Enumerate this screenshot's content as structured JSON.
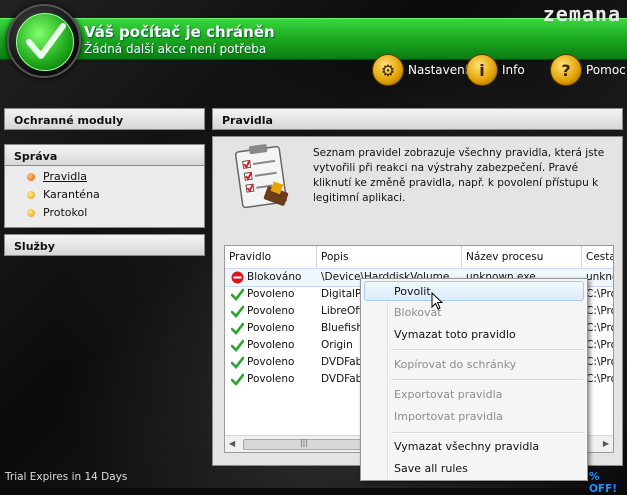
{
  "header": {
    "title": "Váš počítač je chráněn",
    "subtitle": "Žádná další akce není potřeba",
    "brand": "zemana",
    "buttons": [
      {
        "label": "Nastavení",
        "icon": "gear-icon"
      },
      {
        "label": "Info",
        "icon": "info-icon"
      },
      {
        "label": "Pomoc",
        "icon": "help-icon"
      }
    ]
  },
  "sidebar": {
    "modules_title": "Ochranné moduly",
    "management_title": "Správa",
    "items": [
      {
        "label": "Pravidla",
        "active": true
      },
      {
        "label": "Karanténa",
        "active": false
      },
      {
        "label": "Protokol",
        "active": false
      }
    ],
    "services_title": "Služby"
  },
  "main": {
    "title": "Pravidla",
    "description": "Seznam pravidel zobrazuje všechny pravidla, která jste vytvořili při reakci na výstrahy zabezpečení. Pravé kliknutí ke změně pravidla, např. k povolení přístupu k legitimní aplikaci.",
    "table": {
      "columns": [
        "Pravidlo",
        "Popis",
        "Název procesu",
        "Cesta"
      ],
      "rows": [
        {
          "status": "Blokováno",
          "type": "block",
          "popis": "\\Device\\HarddiskVolume",
          "process": "unknown.exe",
          "path": "unkno"
        },
        {
          "status": "Povoleno",
          "type": "allow",
          "popis": "DigitalPe",
          "process": "",
          "path": "C:\\Pro"
        },
        {
          "status": "Povoleno",
          "type": "allow",
          "popis": "LibreOff",
          "process": "",
          "path": "C:\\Pro"
        },
        {
          "status": "Povoleno",
          "type": "allow",
          "popis": "Bluefish",
          "process": "",
          "path": "C:\\Pro"
        },
        {
          "status": "Povoleno",
          "type": "allow",
          "popis": "Origin",
          "process": "",
          "path": "C:\\Pro"
        },
        {
          "status": "Povoleno",
          "type": "allow",
          "popis": "DVDFab",
          "process": "",
          "path": "C:\\Pro"
        },
        {
          "status": "Povoleno",
          "type": "allow",
          "popis": "DVDFab",
          "process": "",
          "path": "C:\\Pro"
        }
      ],
      "scroll_thumb": "|||"
    }
  },
  "context_menu": {
    "items": [
      {
        "label": "Povolit",
        "disabled": false,
        "highlighted": true
      },
      {
        "label": "Blokovat",
        "disabled": true
      },
      {
        "label": "Vymazat toto pravidlo",
        "disabled": false
      },
      {
        "label": "Kopírovat do schránky",
        "disabled": true
      },
      {
        "label": "Exportovat pravidla",
        "disabled": true
      },
      {
        "label": "Importovat pravidla",
        "disabled": true
      },
      {
        "label": "Vymazat všechny pravidla",
        "disabled": false
      },
      {
        "label": "Save all rules",
        "disabled": false
      }
    ]
  },
  "footer": {
    "trial": "Trial Expires in 14 Days",
    "promo": "% OFF!"
  }
}
